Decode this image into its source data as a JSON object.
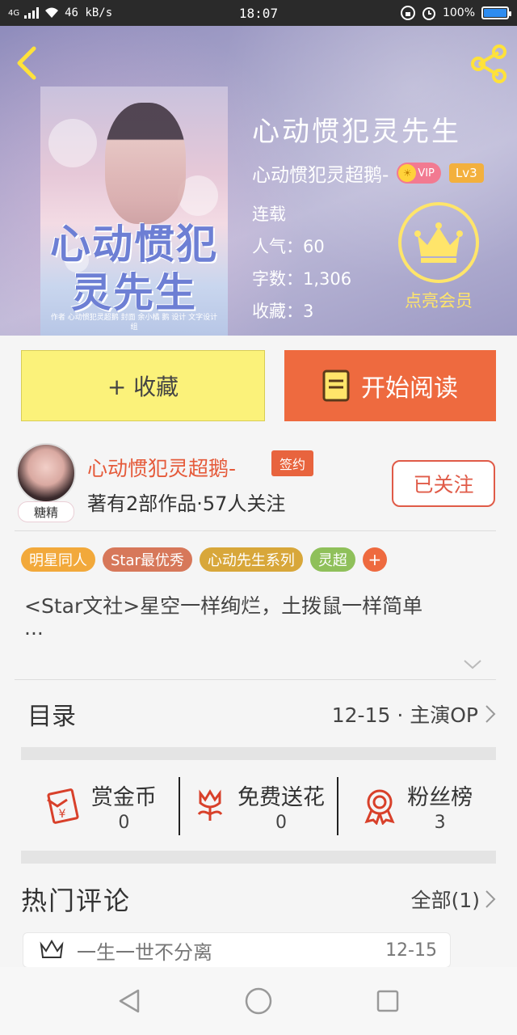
{
  "status_bar": {
    "network": "4G",
    "speed": "46 kB/s",
    "time": "18:07",
    "battery": "100%"
  },
  "book": {
    "cover_title_line1": "心动惯犯",
    "cover_title_line2": "灵先生",
    "cover_credits": "作者 心动惯犯灵超鹅 封面 余小橘 鹅 设计 文字设计组",
    "title": "心动惯犯灵先生",
    "author": "心动惯犯灵超鹅-",
    "vip_label": "VIP",
    "level": "Lv3",
    "status": "连载",
    "popularity_label": "人气：",
    "popularity": "60",
    "wordcount_label": "字数：",
    "wordcount": "1,306",
    "favorites_label": "收藏：",
    "favorites": "3",
    "member_label": "点亮会员"
  },
  "buttons": {
    "favorite": "+ 收藏",
    "start_reading": "开始阅读"
  },
  "author": {
    "avatar_tag": "糖精",
    "name": "心动惯犯灵超鹅-",
    "sign_badge": "签约",
    "stats": "著有2部作品·57人关注",
    "follow": "已关注"
  },
  "tags": [
    {
      "label": "明星同人",
      "color": "#f2a93b"
    },
    {
      "label": "Star最优秀",
      "color": "#d7785a"
    },
    {
      "label": "心动先生系列",
      "color": "#d8a73a"
    },
    {
      "label": "灵超",
      "color": "#8fc05a"
    }
  ],
  "tag_add": "+",
  "description": {
    "line1": "<Star文社>星空一样绚烂，土拨鼠一样简单",
    "line2": "..."
  },
  "toc": {
    "title": "目录",
    "latest": "12-15 · 主演OP"
  },
  "actions": [
    {
      "label": "赏金币",
      "value": "0",
      "icon": "red-envelope-icon"
    },
    {
      "label": "免费送花",
      "value": "0",
      "icon": "flower-icon"
    },
    {
      "label": "粉丝榜",
      "value": "3",
      "icon": "medal-icon"
    }
  ],
  "hot_comments": {
    "title": "热门评论",
    "all": "全部(1)",
    "items": [
      {
        "text": "一生一世不分离",
        "date": "12-15"
      }
    ]
  },
  "colors": {
    "accent_orange": "#ee6a3f",
    "favorite_yellow": "#fbf27a",
    "follow_red": "#e05b48",
    "crown_yellow": "#ffe56a"
  }
}
